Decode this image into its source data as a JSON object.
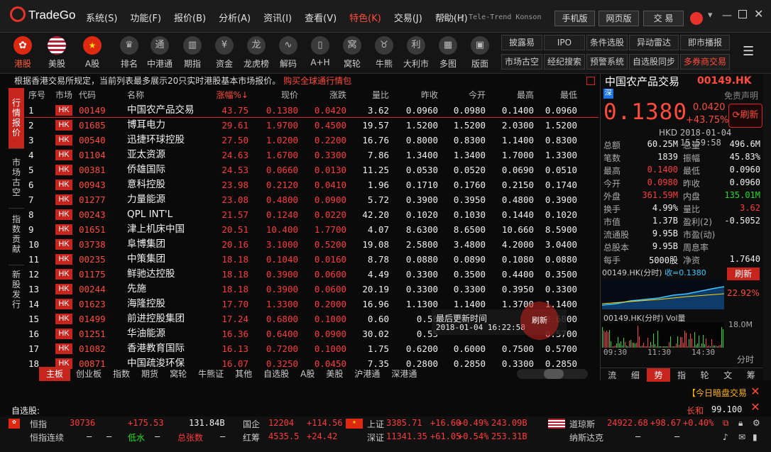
{
  "app": {
    "logo_text": "TradeGo",
    "ticker": "ed..y Tele-Trend Konson"
  },
  "menu": [
    "系统(S)",
    "功能(F)",
    "报价(B)",
    "分析(A)",
    "资讯(I)",
    "查看(V)",
    "特色(K)",
    "交易(J)",
    "帮助(H)"
  ],
  "top_buttons": [
    "手机版",
    "网页版",
    "交 易"
  ],
  "toolbar": {
    "markets": [
      {
        "label": "港股"
      },
      {
        "label": "美股"
      },
      {
        "label": "A股"
      }
    ],
    "tools": [
      "排名",
      "中港通",
      "期指",
      "资金",
      "龙虎榜",
      "解码",
      "A+H",
      "窝轮",
      "牛熊",
      "大利市",
      "多图",
      "版面"
    ],
    "right_buttons": [
      [
        "披露易",
        "IPO",
        "条件选股",
        "异动雷达",
        "即市播报"
      ],
      [
        "市场古空",
        "经纪搜索",
        "预警系统",
        "自选股同步",
        "多券商交易"
      ]
    ]
  },
  "notice": {
    "text": "根据香港交易所规定，当前列表最多展示20只实时港股基本市场报价。",
    "link": "购买全球通行情包"
  },
  "left_tabs": [
    "行情报价",
    "市场古空",
    "指数贡献",
    "新股发行"
  ],
  "table": {
    "headers": [
      "序号",
      "市场",
      "代码",
      "名称",
      "涨幅%↓",
      "现价",
      "涨跌",
      "量比",
      "昨收",
      "今开",
      "最高",
      "最低"
    ],
    "rows": [
      [
        "1",
        "HK",
        "00149",
        "中国农产品交易",
        "43.75",
        "0.1380",
        "0.0420",
        "3.62",
        "0.0960",
        "0.0980",
        "0.1400",
        "0.0960"
      ],
      [
        "2",
        "HK",
        "01685",
        "博耳电力",
        "29.61",
        "1.9700",
        "0.4500",
        "19.57",
        "1.5200",
        "1.5200",
        "2.0300",
        "1.5200"
      ],
      [
        "3",
        "HK",
        "00540",
        "迅捷环球控股",
        "27.50",
        "1.0200",
        "0.2200",
        "16.76",
        "0.8000",
        "0.8300",
        "1.1400",
        "0.8300"
      ],
      [
        "4",
        "HK",
        "01104",
        "亚太资源",
        "24.63",
        "1.6700",
        "0.3300",
        "7.86",
        "1.3400",
        "1.3400",
        "1.7000",
        "1.3300"
      ],
      [
        "5",
        "HK",
        "00381",
        "侨雄国际",
        "24.53",
        "0.0660",
        "0.0130",
        "11.25",
        "0.0530",
        "0.0520",
        "0.0690",
        "0.0510"
      ],
      [
        "6",
        "HK",
        "00943",
        "意科控股",
        "23.98",
        "0.2120",
        "0.0410",
        "1.96",
        "0.1710",
        "0.1760",
        "0.2150",
        "0.1740"
      ],
      [
        "7",
        "HK",
        "01277",
        "力量能源",
        "23.08",
        "0.4800",
        "0.0900",
        "5.72",
        "0.3900",
        "0.3950",
        "0.4800",
        "0.3900"
      ],
      [
        "8",
        "HK",
        "00243",
        "QPL INT'L",
        "21.57",
        "0.1240",
        "0.0220",
        "42.20",
        "0.1020",
        "0.1030",
        "0.1440",
        "0.1020"
      ],
      [
        "9",
        "HK",
        "01651",
        "津上机床中国",
        "20.51",
        "10.400",
        "1.7700",
        "4.07",
        "8.6300",
        "8.6500",
        "10.660",
        "8.5900"
      ],
      [
        "10",
        "HK",
        "03738",
        "阜博集团",
        "20.16",
        "3.1000",
        "0.5200",
        "19.08",
        "2.5800",
        "3.4800",
        "4.2000",
        "3.0400"
      ],
      [
        "11",
        "HK",
        "00235",
        "中策集团",
        "18.18",
        "0.1040",
        "0.0160",
        "8.78",
        "0.0880",
        "0.0890",
        "0.1080",
        "0.0880"
      ],
      [
        "12",
        "HK",
        "01175",
        "鲜驰达控股",
        "18.18",
        "0.3900",
        "0.0600",
        "4.49",
        "0.3300",
        "0.3500",
        "0.4400",
        "0.3500"
      ],
      [
        "13",
        "HK",
        "00244",
        "先施",
        "18.18",
        "0.3900",
        "0.0600",
        "20.19",
        "0.3300",
        "0.3300",
        "0.3950",
        "0.3300"
      ],
      [
        "14",
        "HK",
        "01623",
        "海隆控股",
        "17.70",
        "1.3300",
        "0.2000",
        "16.96",
        "1.1300",
        "1.1400",
        "1.3700",
        "1.1400"
      ],
      [
        "15",
        "HK",
        "01499",
        "前进控股集团",
        "17.24",
        "0.6800",
        "0.1000",
        "0.60",
        "0.58",
        "",
        "",
        "0.6800"
      ],
      [
        "16",
        "HK",
        "01251",
        "华油能源",
        "16.36",
        "0.6400",
        "0.0900",
        "30.02",
        "0.55",
        "",
        "",
        "0.5700"
      ],
      [
        "17",
        "HK",
        "01082",
        "香港教育国际",
        "16.13",
        "0.7200",
        "0.1000",
        "1.75",
        "0.6200",
        "0.6000",
        "0.7500",
        "0.5700"
      ],
      [
        "18",
        "HK",
        "00871",
        "中国疏浚环保",
        "16.07",
        "0.3250",
        "0.0450",
        "7.35",
        "0.2800",
        "0.2850",
        "0.3300",
        "0.2850"
      ]
    ]
  },
  "tooltip": {
    "title": "最后更新时间",
    "time": "2018-01-04 16:22:58",
    "refresh": "刷新"
  },
  "bottom_tabs": [
    "主板",
    "创业板",
    "指数",
    "期货",
    "窝轮",
    "牛熊证",
    "其他",
    "自选股",
    "A股",
    "美股",
    "沪港通",
    "深港通"
  ],
  "quote": {
    "name": "中国农产品交易",
    "code": "00149.HK",
    "badge": "深",
    "disclaimer": "免责声明",
    "price": "0.1380",
    "change": "0.0420",
    "pct": "+43.75%",
    "refresh": "刷新",
    "currency": "HKD",
    "datetime": "2018-01-04 15:59:58",
    "stats": [
      [
        "总额",
        "60.25M",
        "总量",
        "496.6M"
      ],
      [
        "笔数",
        "1839",
        "振幅",
        "45.83%"
      ],
      [
        "最高",
        "0.1400",
        "最低",
        "0.0960"
      ],
      [
        "今开",
        "0.0980",
        "昨收",
        "0.0960"
      ],
      [
        "外盘",
        "361.59M",
        "内盘",
        "135.01M"
      ],
      [
        "换手",
        "4.99%",
        "量比",
        "3.62"
      ],
      [
        "市值",
        "1.37B",
        "盈利(2)",
        "-0.5052"
      ],
      [
        "流通股",
        "9.95B",
        "市盈(动)",
        ""
      ],
      [
        "总股本",
        "9.95B",
        "周息率",
        ""
      ],
      [
        "每手",
        "5000股",
        "净资",
        "1.7640"
      ]
    ],
    "mini_chart": {
      "code": "00149.HK(分时)",
      "label": "收=0.1380",
      "refresh": "刷新",
      "pct": "22.92%"
    },
    "vol_chart": {
      "label": "00149.HK(分时) Vol量",
      "max": "18.0M",
      "times": [
        "09:30",
        "11:30",
        "14:30"
      ],
      "btn": "分时"
    },
    "tabs": [
      "流",
      "细",
      "势",
      "指",
      "轮",
      "文",
      "筹"
    ]
  },
  "alert": {
    "text": "【今日暗盘交易"
  },
  "watch": {
    "label": "自选股:",
    "name": "长和",
    "price": "99.100"
  },
  "indices": {
    "row1": [
      [
        "恒指",
        "30736",
        "+175.53",
        "131.84B"
      ],
      [
        "国企",
        "12204",
        "+114.56",
        ""
      ],
      [
        "上证",
        "3385.71",
        "+16.60",
        "+0.49%",
        "243.09B"
      ],
      [
        "道琼斯",
        "24922.68",
        "+98.67",
        "+0.40%"
      ]
    ],
    "row2": [
      [
        "恒指连续",
        "–",
        "–",
        "低水",
        "–",
        "总张数",
        "–"
      ],
      [
        "红筹",
        "4535.5",
        "+24.42"
      ],
      [
        "深证",
        "11341.35",
        "+61.05",
        "+0.54%",
        "253.31B"
      ],
      [
        "纳斯达克",
        "–",
        "–"
      ]
    ]
  }
}
